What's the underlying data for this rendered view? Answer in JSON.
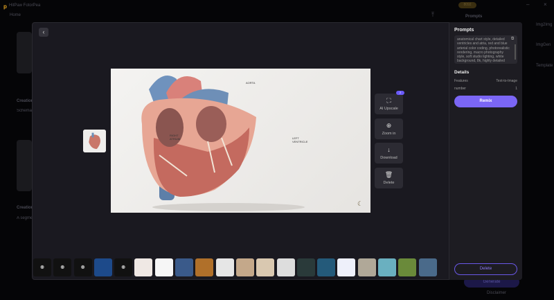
{
  "app": {
    "title": "HitPaw FotorPea",
    "home": "Home",
    "credits": "8092"
  },
  "background": {
    "right_tabs": [
      {
        "label": "Img2Img"
      },
      {
        "label": "ImgGen"
      },
      {
        "label": "Template"
      }
    ],
    "prompts_header": "Prompts",
    "creations": [
      {
        "title": "Creation",
        "desc": "Schematic precise structure"
      },
      {
        "title": "Creation",
        "desc": "A segment screen."
      }
    ],
    "generate": "Generate",
    "disclaimer": "Disclaimer"
  },
  "viewer": {
    "image_labels": {
      "aorta": "AORTA",
      "right_atrium": "RIGHT ATRIUM",
      "left_ventricle": "LEFT VENTRICLE"
    },
    "actions": [
      {
        "label": "AI Upscale",
        "icon": "upscale-icon",
        "badge": "2"
      },
      {
        "label": "Zoom in",
        "icon": "zoom-in-icon"
      },
      {
        "label": "Download",
        "icon": "download-icon"
      },
      {
        "label": "Delete",
        "icon": "trash-icon"
      }
    ],
    "thumbnails_count": 20
  },
  "panel": {
    "prompts_title": "Prompts",
    "prompt_text": "anatomical chart style, detailed ventricles and atria, red and blue arterial color coding, photorealistic rendering, macro photography style, soft studio lighting, white background, 8k, highly detailed",
    "details_title": "Details",
    "details": [
      {
        "key": "Features",
        "value": "Text-to-Image"
      },
      {
        "key": "number",
        "value": "1"
      }
    ],
    "remix": "Remix",
    "delete": "Delete"
  },
  "colors": {
    "accent": "#7b66f5",
    "modal_bg": "#1a1920"
  }
}
